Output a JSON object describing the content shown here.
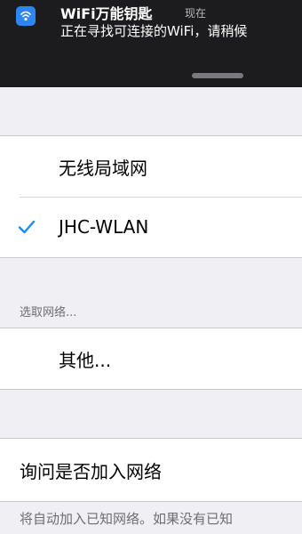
{
  "notification": {
    "app_name": "WiFi万能钥匙",
    "time": "现在",
    "message": "正在寻找可连接的WiFi，请稍候",
    "icon": "wifi-key-icon",
    "accent_color": "#2e86f2"
  },
  "wifi_section": {
    "title_row_label": "无线局域网",
    "connected_network": "JHC-WLAN",
    "checkmark_color": "#1a8cff"
  },
  "choose_network": {
    "header": "选取网络...",
    "other_label": "其他..."
  },
  "ask_to_join": {
    "label": "询问是否加入网络",
    "footer": "将自动加入已知网络。如果没有已知"
  }
}
